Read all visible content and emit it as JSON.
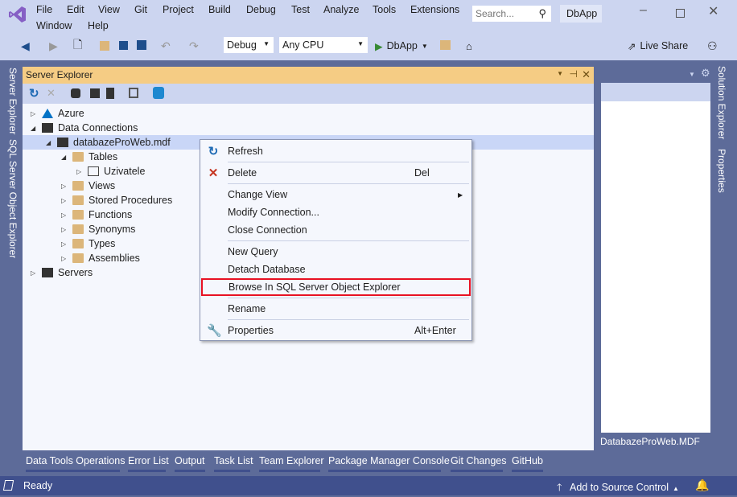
{
  "menu": [
    "File",
    "Edit",
    "View",
    "Git",
    "Project",
    "Build",
    "Debug",
    "Test",
    "Analyze",
    "Tools",
    "Extensions",
    "Window",
    "Help"
  ],
  "search": {
    "placeholder": "Search..."
  },
  "solution_name": "DbApp",
  "toolbar": {
    "config": "Debug",
    "platform": "Any CPU",
    "run_label": "DbApp",
    "live_share": "Live Share"
  },
  "left_tabs": [
    "Server Explorer",
    "SQL Server Object Explorer"
  ],
  "right_tabs": [
    "Solution Explorer",
    "Properties"
  ],
  "server_explorer": {
    "title": "Server Explorer",
    "tree": [
      {
        "label": "Azure",
        "expander": "collapsed",
        "icon": "azure-icon"
      },
      {
        "label": "Data Connections",
        "expander": "expanded",
        "icon": "data-connections-icon"
      },
      {
        "label": "databazeProWeb.mdf",
        "expander": "expanded",
        "icon": "database-icon",
        "selected": true
      },
      {
        "label": "Tables",
        "expander": "expanded",
        "icon": "folder-icon"
      },
      {
        "label": "Uzivatele",
        "expander": "collapsed",
        "icon": "table-icon"
      },
      {
        "label": "Views",
        "expander": "collapsed",
        "icon": "folder-icon"
      },
      {
        "label": "Stored Procedures",
        "expander": "collapsed",
        "icon": "folder-icon"
      },
      {
        "label": "Functions",
        "expander": "collapsed",
        "icon": "folder-icon"
      },
      {
        "label": "Synonyms",
        "expander": "collapsed",
        "icon": "folder-icon"
      },
      {
        "label": "Types",
        "expander": "collapsed",
        "icon": "folder-icon"
      },
      {
        "label": "Assemblies",
        "expander": "collapsed",
        "icon": "folder-icon"
      },
      {
        "label": "Servers",
        "expander": "collapsed",
        "icon": "servers-icon"
      }
    ]
  },
  "context_menu": [
    {
      "label": "Refresh",
      "icon": "refresh-icon"
    },
    {
      "label": "Delete",
      "shortcut": "Del",
      "icon": "delete-icon"
    },
    {
      "label": "Change View",
      "submenu": true
    },
    {
      "label": "Modify Connection..."
    },
    {
      "label": "Close Connection"
    },
    {
      "label": "New Query"
    },
    {
      "label": "Detach Database"
    },
    {
      "label": "Browse In SQL Server Object Explorer",
      "highlighted": true
    },
    {
      "label": "Rename"
    },
    {
      "label": "Properties",
      "shortcut": "Alt+Enter",
      "icon": "wrench-icon"
    }
  ],
  "right_panel_label": "DatabazeProWeb.MDF",
  "bottom_tabs": [
    "Data Tools Operations",
    "Error List",
    "Output",
    "Task List",
    "Team Explorer",
    "Package Manager Console",
    "Git Changes",
    "GitHub"
  ],
  "status": {
    "text": "Ready",
    "source_control": "Add to Source Control"
  },
  "colors": {
    "accent": "#68217a",
    "panel_header": "#f5cc84",
    "status_bar": "#40508d",
    "highlight_border": "#e81123"
  }
}
